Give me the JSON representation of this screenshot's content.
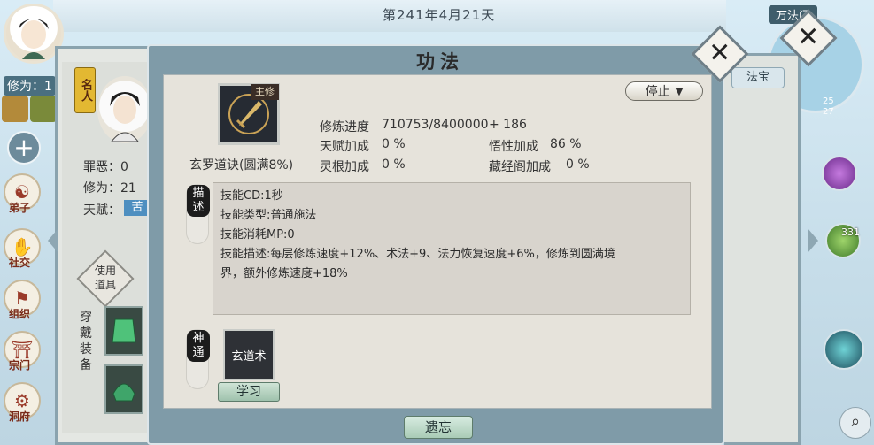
{
  "top": {
    "date": "第241年4月21天",
    "cultivation_label": "修为：1"
  },
  "left_nav": [
    {
      "label": "弟子",
      "icon": "disciple-icon"
    },
    {
      "label": "社交",
      "icon": "social-icon"
    },
    {
      "label": "组织",
      "icon": "organization-icon"
    },
    {
      "label": "宗门",
      "icon": "sect-gate-icon"
    },
    {
      "label": "洞府",
      "icon": "cave-icon"
    }
  ],
  "right_hud": {
    "region": "万法门",
    "count": "331",
    "map_numbers": [
      "25",
      "27"
    ],
    "treasure_tab": "法宝"
  },
  "character_panel": {
    "name_tag": "名人",
    "stats": [
      {
        "label": "罪恶：",
        "value": "0"
      },
      {
        "label": "修为：",
        "value": "21"
      },
      {
        "label": "天赋：",
        "value": "苦"
      }
    ],
    "use_item": "使用道具",
    "equip_label": "穿戴装备"
  },
  "dialog": {
    "title": "功法",
    "stop_button": "停止",
    "skill": {
      "badge": "主修",
      "name": "玄罗道诀(圆满8%)",
      "icon": "sword-icon"
    },
    "info": {
      "progress_label": "修炼进度",
      "progress_value": "710753/8400000",
      "progress_bonus": "+ 186",
      "rows": [
        {
          "left_label": "天赋加成",
          "left_value": "0 %",
          "right_label": "悟性加成",
          "right_value": "86 %"
        },
        {
          "left_label": "灵根加成",
          "left_value": "0 %",
          "right_label": "藏经阁加成",
          "right_value": "0 %"
        }
      ]
    },
    "desc_label": "描述",
    "description": [
      "技能CD:1秒",
      "技能类型:普通施法",
      "技能消耗MP:0",
      "技能描述:每层修炼速度+12%、术法+9、法力恢复速度+6%，修炼到圆满境",
      "界，额外修炼速度+18%"
    ],
    "divine_label": "神通",
    "divine_skill": "玄道术",
    "learn_button": "学习",
    "forget_button": "遗忘"
  }
}
